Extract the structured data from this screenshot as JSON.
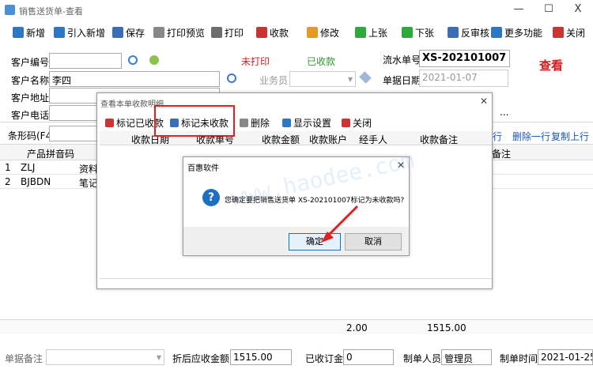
{
  "window": {
    "title": "销售送货单-查看",
    "close_label": "X"
  },
  "toolbar": [
    {
      "label": "新增",
      "icon": "plus-icon",
      "color": "#2b78c5"
    },
    {
      "label": "引入新增",
      "icon": "import-icon",
      "color": "#2b78c5"
    },
    {
      "label": "保存",
      "icon": "save-icon",
      "color": "#3a6fb5"
    },
    {
      "label": "打印预览",
      "icon": "print-preview-icon",
      "color": "#888888"
    },
    {
      "label": "打印",
      "icon": "print-icon",
      "color": "#6d6d6d"
    },
    {
      "label": "收款",
      "icon": "collect-icon",
      "color": "#cc3333"
    },
    {
      "label": "修改",
      "icon": "edit-icon",
      "color": "#e69a1e"
    },
    {
      "label": "上张",
      "icon": "prev-icon",
      "color": "#2eaa3a"
    },
    {
      "label": "下张",
      "icon": "next-icon",
      "color": "#2eaa3a"
    },
    {
      "label": "反审核",
      "icon": "unaudit-icon",
      "color": "#3a6fb5"
    },
    {
      "label": "更多功能",
      "icon": "gear-icon",
      "color": "#2b78c5"
    },
    {
      "label": "关闭",
      "icon": "close-icon",
      "color": "#cc3333"
    }
  ],
  "header": {
    "customer_code_label": "客户编号",
    "customer_code_value": "",
    "customer_name_label": "客户名称",
    "customer_name_value": "李四",
    "customer_address_label": "客户地址",
    "customer_phone_label": "客户电话",
    "not_printed": "未打印",
    "received": "已收款",
    "serial_label": "流水单号",
    "serial_value": "XS-202101007",
    "view_text": "查看",
    "salesman_label": "业务员",
    "date_label": "单据日期",
    "date_value": "2021-01-07",
    "barcode_label": "条形码(F4)"
  },
  "row_actions": {
    "add": "行",
    "delete": "删除一行",
    "copy": "复制上行"
  },
  "product_grid": {
    "columns": [
      "产品拼音码",
      "资料"
    ],
    "rows": [
      {
        "no": "1",
        "code": "ZLJ",
        "name": "资料"
      },
      {
        "no": "2",
        "code": "BJBDN",
        "name": "笔记"
      }
    ],
    "remark_col": "备注",
    "total_qty": "2.00",
    "total_amount": "1515.00"
  },
  "footer": {
    "remark_label": "单据备注",
    "discount_label": "折后应收金额",
    "discount_value": "1515.00",
    "received_label": "已收订金",
    "received_value": "0",
    "maker_label": "制单人员",
    "maker_value": "管理员",
    "time_label": "制单时间",
    "time_value": "2021-01-25"
  },
  "receipt_dialog": {
    "title": "查看本单收款明细",
    "buttons": [
      "标记已收款",
      "标记未收款",
      "删除",
      "显示设置",
      "关闭"
    ],
    "columns": [
      "收款日期",
      "收款单号",
      "收款金额",
      "收款账户",
      "经手人",
      "收款备注"
    ]
  },
  "confirm_dialog": {
    "title": "百惠软件",
    "message": "您确定要把销售送货单 XS-202101007标记为未收款吗?",
    "ok": "确定",
    "cancel": "取消"
  },
  "watermark": "www.haodee.com",
  "colors": {
    "accent": "#0078d7",
    "highlight": "#e02020",
    "question": "#1e6fc4"
  }
}
